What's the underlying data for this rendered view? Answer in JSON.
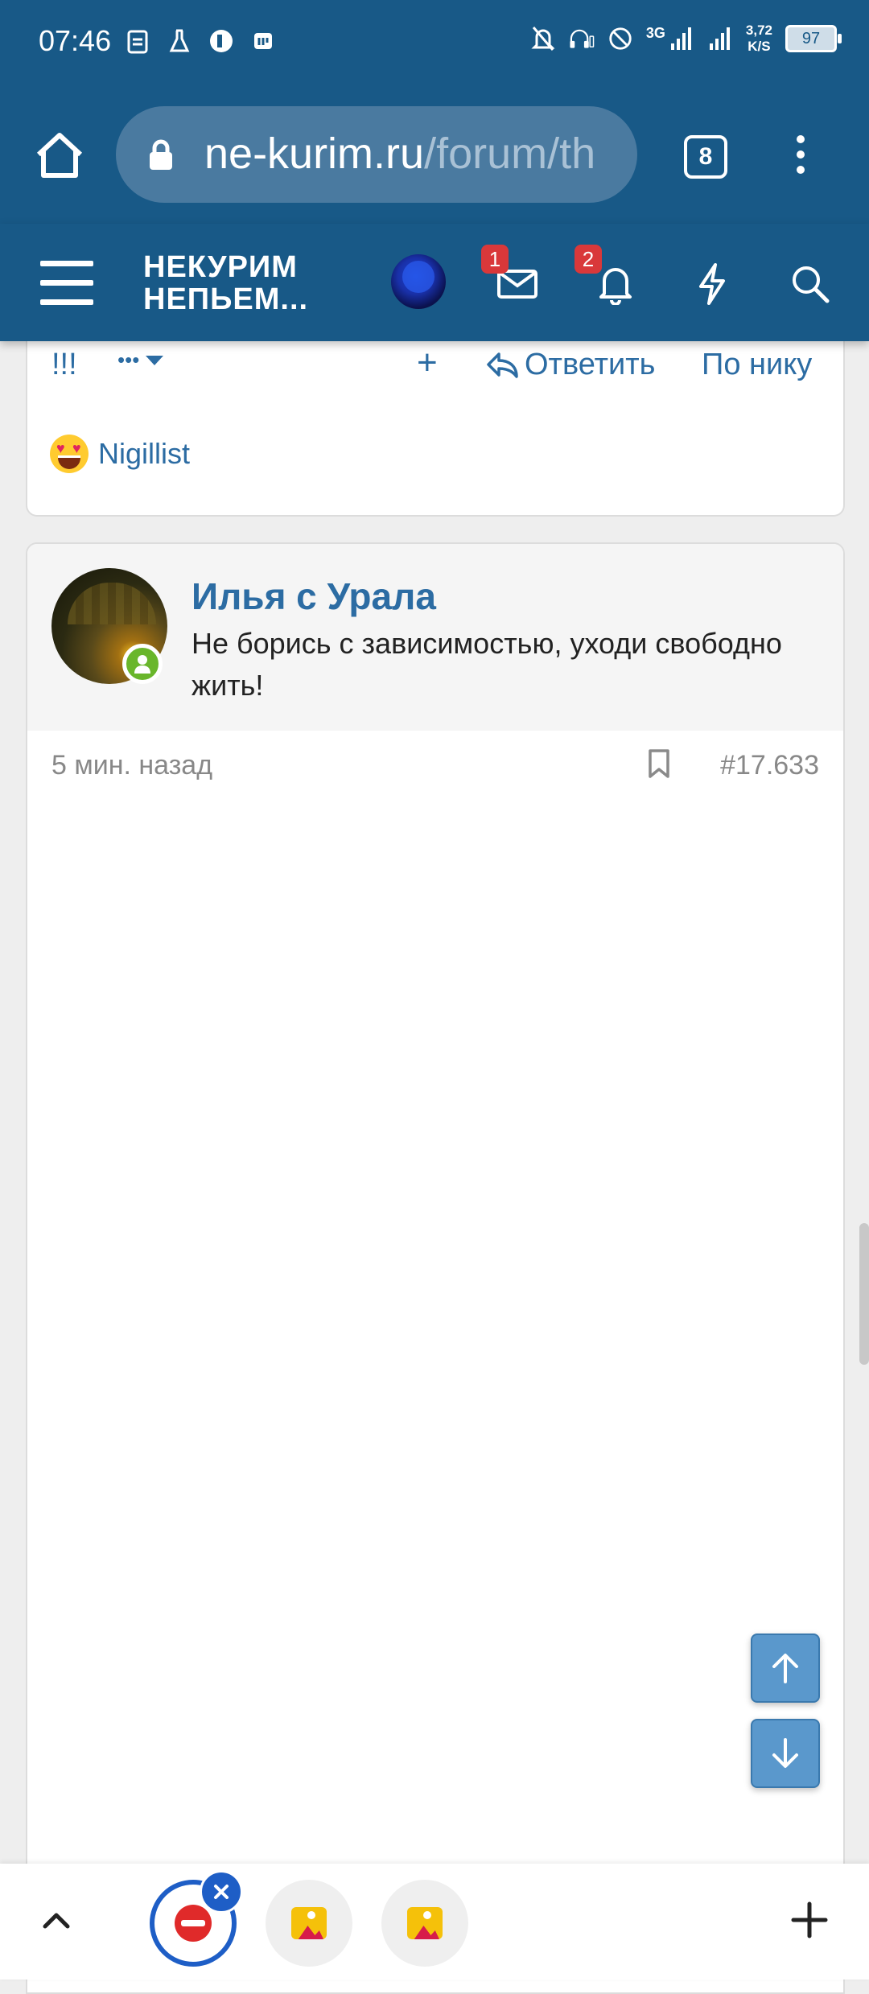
{
  "status_bar": {
    "time": "07:46",
    "network": "3G",
    "speed_value": "3,72",
    "speed_unit": "K/S",
    "battery": "97"
  },
  "browser": {
    "url_host": "ne-kurim.ru",
    "url_path": "/forum/th",
    "tab_count": "8"
  },
  "site_header": {
    "logo_line1": "НЕКУРИМ",
    "logo_line2": "НЕПЬЕМ...",
    "messages_badge": "1",
    "alerts_badge": "2"
  },
  "previous_post": {
    "actions": {
      "marks": "!!!",
      "more": "•••",
      "add": "+",
      "reply": "Ответить",
      "by_nick": "По нику"
    },
    "reaction_user": "Nigillist"
  },
  "post": {
    "author": "Илья с Урала",
    "user_title": "Не борись с зависимостью, уходи свободно жить!",
    "time_ago": "5 мин. назад",
    "post_number": "#17.633"
  },
  "colors": {
    "header_blue": "#185987",
    "link_blue": "#2c6ca3",
    "badge_red": "#d9383a",
    "online_green": "#69b62b"
  }
}
